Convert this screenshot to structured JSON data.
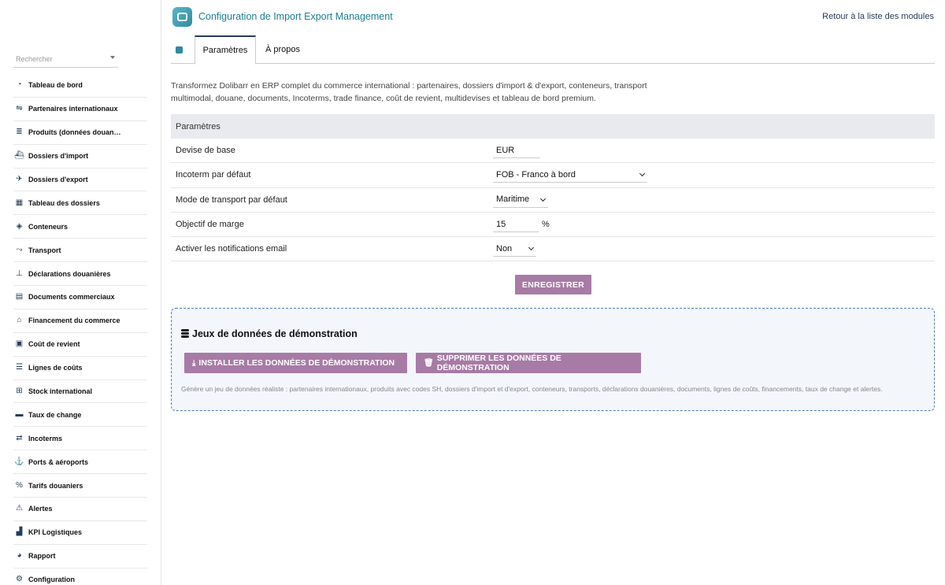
{
  "header": {
    "title": "Configuration de Import Export Management",
    "back_link": "Retour à la liste des modules"
  },
  "sidebar": {
    "search_placeholder": "Rechercher",
    "items": [
      {
        "label": "Tableau de bord",
        "icon": "dashboard-icon"
      },
      {
        "label": "Partenaires internationaux",
        "icon": "handshake-icon"
      },
      {
        "label": "Produits (données douaniè...",
        "icon": "barcode-icon"
      },
      {
        "label": "Dossiers d'import",
        "icon": "ship-icon"
      },
      {
        "label": "Dossiers d'export",
        "icon": "plane-icon"
      },
      {
        "label": "Tableau des dossiers",
        "icon": "table-icon"
      },
      {
        "label": "Conteneurs",
        "icon": "box-icon"
      },
      {
        "label": "Transport",
        "icon": "route-icon"
      },
      {
        "label": "Déclarations douanières",
        "icon": "stamp-icon"
      },
      {
        "label": "Documents commerciaux",
        "icon": "document-icon"
      },
      {
        "label": "Financement du commerce",
        "icon": "bank-icon"
      },
      {
        "label": "Coût de revient",
        "icon": "calculator-icon"
      },
      {
        "label": "Lignes de coûts",
        "icon": "list-icon"
      },
      {
        "label": "Stock international",
        "icon": "warehouse-icon"
      },
      {
        "label": "Taux de change",
        "icon": "money-icon"
      },
      {
        "label": "Incoterms",
        "icon": "exchange-icon"
      },
      {
        "label": "Ports & aéroports",
        "icon": "anchor-icon"
      },
      {
        "label": "Tarifs douaniers",
        "icon": "percent-icon"
      },
      {
        "label": "Alertes",
        "icon": "warning-icon"
      },
      {
        "label": "KPI Logistiques",
        "icon": "chart-icon"
      },
      {
        "label": "Rapport",
        "icon": "pie-icon"
      },
      {
        "label": "Configuration",
        "icon": "gear-icon"
      }
    ]
  },
  "tabs": {
    "settings": "Paramètres",
    "about": "À propos"
  },
  "intro": "Transformez Dolibarr en ERP complet du commerce international : partenaires, dossiers d'import & d'export, conteneurs, transport multimodal, douane, documents, Incoterms, trade finance, coût de revient, multidevises et tableau de bord premium.",
  "params": {
    "header": "Paramètres",
    "rows": [
      {
        "label": "Devise de base",
        "value": "EUR"
      },
      {
        "label": "Incoterm par défaut",
        "value": "FOB - Franco à bord"
      },
      {
        "label": "Mode de transport par défaut",
        "value": "Maritime"
      },
      {
        "label": "Objectif de marge",
        "value": "15",
        "unit": "%"
      },
      {
        "label": "Activer les notifications email",
        "value": "Non"
      }
    ],
    "save_label": "ENREGISTRER"
  },
  "demo": {
    "title": "Jeux de données de démonstration",
    "install_label": "INSTALLER LES DONNÉES DE DÉMONSTRATION",
    "delete_label": "SUPPRIMER LES DONNÉES DE DÉMONSTRATION",
    "note": "Génère un jeu de données réaliste : partenaires internationaux, produits avec codes SH, dossiers d'import et d'export, conteneurs, transports, déclarations douanières, documents, lignes de coûts, financements, taux de change et alertes."
  },
  "colors": {
    "accent": "#a77ba6",
    "title": "#1a7e92",
    "nav": "#263c5c",
    "demo_border": "#4d7cc0"
  }
}
